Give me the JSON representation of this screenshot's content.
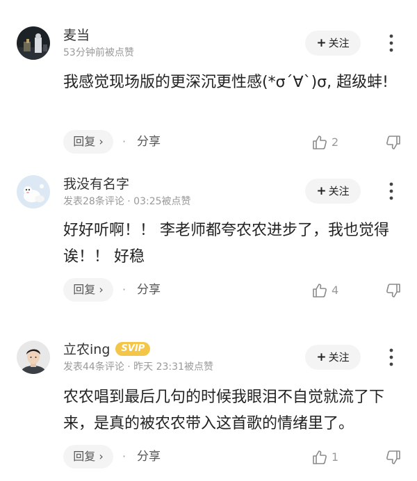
{
  "comments": [
    {
      "username": "麦当",
      "badge": "",
      "meta": "53分钟前被点赞",
      "follow_label": "关注",
      "text": "我感觉现场版的更深沉更性感(*σ´∀`)σ, 超级蚌!",
      "reply_label": "回复 ›",
      "share_label": "分享",
      "like_count": "2"
    },
    {
      "username": "我没有名字",
      "badge": "",
      "meta": "发表28条评论 · 03:25被点赞",
      "follow_label": "关注",
      "text": "好好听啊！！ 李老师都夸农农进步了，我也觉得诶！！ 好稳",
      "reply_label": "回复 ›",
      "share_label": "分享",
      "like_count": "4"
    },
    {
      "username": "立农ing",
      "badge": "SVIP",
      "meta": "发表44条评论 · 昨天 23:31被点赞",
      "follow_label": "关注",
      "text": "农农唱到最后几句的时候我眼泪不自觉就流了下来，是真的被农农带入这首歌的情绪里了。",
      "reply_label": "回复 ›",
      "share_label": "分享",
      "like_count": "1"
    }
  ],
  "colors": {
    "muted": "#999999",
    "button_bg": "#f4f4f4",
    "svip": "#f3c64a"
  }
}
